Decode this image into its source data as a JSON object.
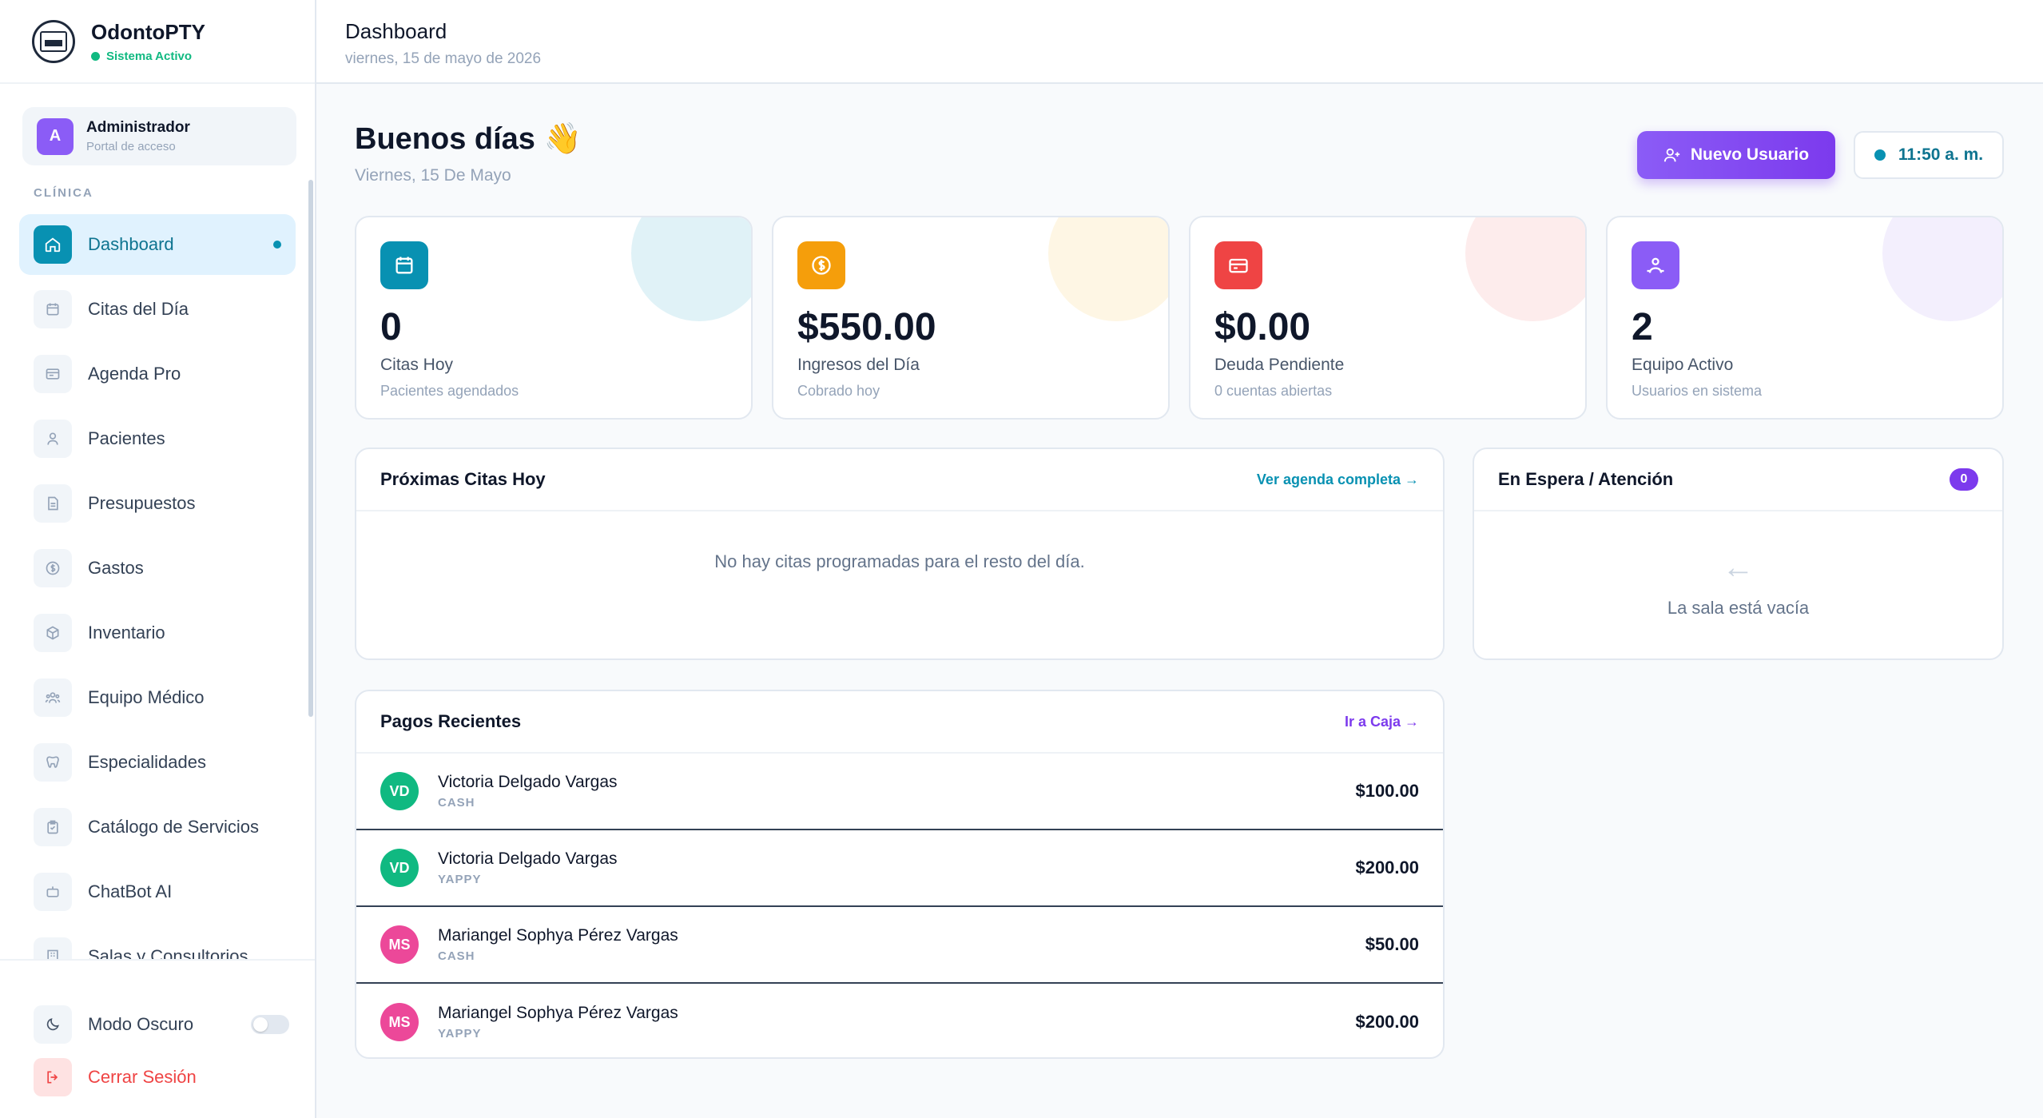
{
  "brand": {
    "name": "OdontoPTY",
    "status": "Sistema Activo"
  },
  "user": {
    "initial": "A",
    "name": "Administrador",
    "role": "Portal de acceso"
  },
  "sidebar": {
    "section_label": "CLÍNICA",
    "items": [
      {
        "label": "Dashboard",
        "icon": "home-icon",
        "active": true
      },
      {
        "label": "Citas del Día",
        "icon": "calendar-icon"
      },
      {
        "label": "Agenda Pro",
        "icon": "agenda-icon"
      },
      {
        "label": "Pacientes",
        "icon": "user-icon"
      },
      {
        "label": "Presupuestos",
        "icon": "document-icon"
      },
      {
        "label": "Gastos",
        "icon": "dollar-icon"
      },
      {
        "label": "Inventario",
        "icon": "box-icon"
      },
      {
        "label": "Equipo Médico",
        "icon": "team-icon"
      },
      {
        "label": "Especialidades",
        "icon": "tooth-icon"
      },
      {
        "label": "Catálogo de Servicios",
        "icon": "clipboard-icon"
      },
      {
        "label": "ChatBot AI",
        "icon": "bot-icon"
      },
      {
        "label": "Salas y Consultorios",
        "icon": "building-icon"
      }
    ],
    "dark_mode_label": "Modo Oscuro",
    "dark_mode_on": false,
    "logout_label": "Cerrar Sesión"
  },
  "topbar": {
    "title": "Dashboard",
    "date": "viernes, 15 de mayo de 2026"
  },
  "greeting": {
    "title": "Buenos días 👋",
    "subtitle": "Viernes, 15 De Mayo"
  },
  "actions": {
    "new_user_label": "Nuevo Usuario",
    "clock": "11:50 a. m."
  },
  "stats": [
    {
      "value": "0",
      "label": "Citas Hoy",
      "sub": "Pacientes agendados",
      "color": "#0891b2",
      "blob": "#e0f2f7",
      "icon": "calendar-icon"
    },
    {
      "value": "$550.00",
      "label": "Ingresos del Día",
      "sub": "Cobrado hoy",
      "color": "#f59e0b",
      "blob": "#fef6e4",
      "icon": "coin-icon"
    },
    {
      "value": "$0.00",
      "label": "Deuda Pendiente",
      "sub": "0 cuentas abiertas",
      "color": "#ef4444",
      "blob": "#fdecec",
      "icon": "credit-card-icon"
    },
    {
      "value": "2",
      "label": "Equipo Activo",
      "sub": "Usuarios en sistema",
      "color": "#8b5cf6",
      "blob": "#f3effd",
      "icon": "team-icon"
    }
  ],
  "upcoming": {
    "title": "Próximas Citas Hoy",
    "link": "Ver agenda completa →",
    "empty": "No hay citas programadas para el resto del día."
  },
  "waiting": {
    "title": "En Espera / Atención",
    "count": "0",
    "arrow": "←",
    "empty": "La sala está vacía"
  },
  "payments": {
    "title": "Pagos Recientes",
    "link": "Ir a Caja →",
    "rows": [
      {
        "initials": "VD",
        "name": "Victoria Delgado Vargas",
        "method": "CASH",
        "amount": "$100.00",
        "color": "#10b981"
      },
      {
        "initials": "VD",
        "name": "Victoria Delgado Vargas",
        "method": "YAPPY",
        "amount": "$200.00",
        "color": "#10b981"
      },
      {
        "initials": "MS",
        "name": "Mariangel Sophya Pérez Vargas",
        "method": "CASH",
        "amount": "$50.00",
        "color": "#ec4899"
      },
      {
        "initials": "MS",
        "name": "Mariangel Sophya Pérez Vargas",
        "method": "YAPPY",
        "amount": "$200.00",
        "color": "#ec4899"
      }
    ]
  }
}
